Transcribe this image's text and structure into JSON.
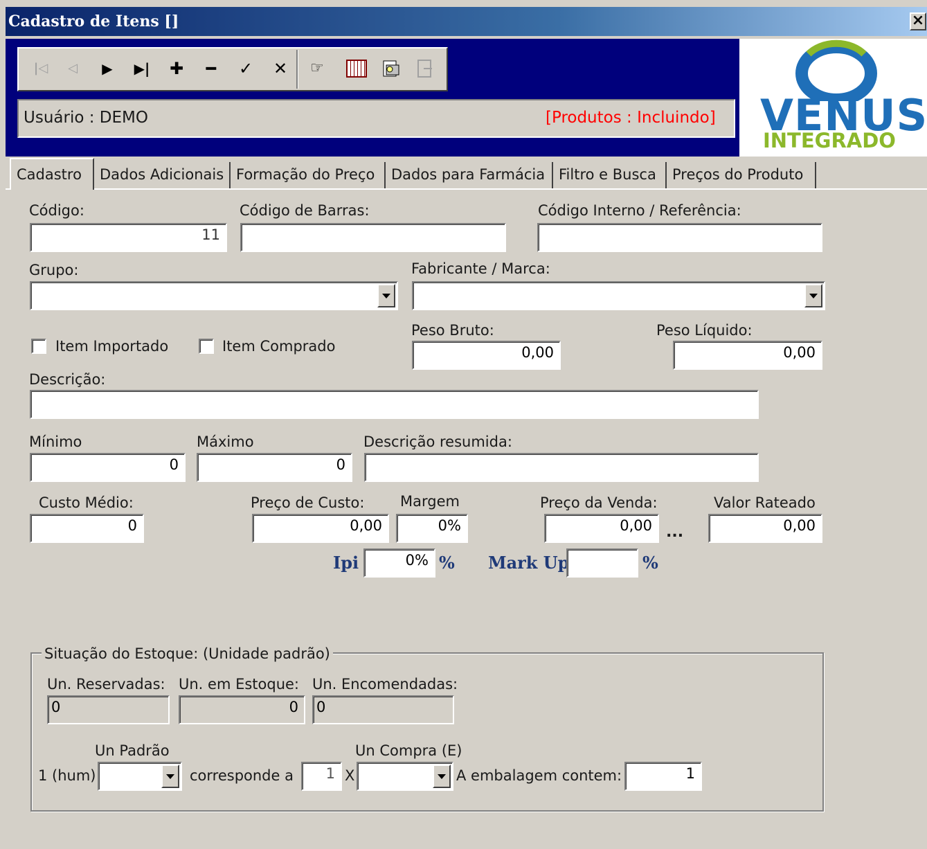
{
  "window": {
    "title": "Cadastro de Itens []",
    "close_label": "×"
  },
  "toolbar": {
    "icons": [
      "first-record-icon",
      "prev-record-icon",
      "next-record-icon",
      "last-record-icon",
      "add-icon",
      "remove-icon",
      "confirm-icon",
      "cancel-icon",
      "pointer-hand-icon",
      "calendar-grid-icon",
      "print-preview-icon",
      "exit-icon"
    ]
  },
  "status": {
    "user": "Usuário : DEMO",
    "mode": "[Produtos : Incluindo]",
    "mode_color": "#ff0000"
  },
  "logo": {
    "top": "VENUS",
    "bottom": "INTEGRADO",
    "brand_color": "#1f6fb8",
    "accent_color": "#8cb82b"
  },
  "tabs": [
    {
      "label": "Cadastro"
    },
    {
      "label": "Dados Adicionais"
    },
    {
      "label": "Formação do Preço"
    },
    {
      "label": "Dados para Farmácia"
    },
    {
      "label": "Filtro e Busca"
    },
    {
      "label": "Preços do Produto"
    }
  ],
  "form": {
    "codigo": {
      "label": "Código:",
      "value": "11"
    },
    "codigo_barras": {
      "label": "Código de Barras:",
      "value": ""
    },
    "codigo_interno": {
      "label": "Código Interno / Referência:",
      "value": ""
    },
    "grupo": {
      "label": "Grupo:",
      "value": ""
    },
    "fabricante": {
      "label": "Fabricante / Marca:",
      "value": ""
    },
    "item_importado": {
      "label": "Item Importado"
    },
    "item_comprado": {
      "label": "Item Comprado"
    },
    "peso_bruto": {
      "label": "Peso Bruto:",
      "value": "0,00"
    },
    "peso_liquido": {
      "label": "Peso Líquido:",
      "value": "0,00"
    },
    "descricao": {
      "label": "Descrição:",
      "value": ""
    },
    "minimo": {
      "label": "Mínimo",
      "value": "0"
    },
    "maximo": {
      "label": "Máximo",
      "value": "0"
    },
    "descricao_resumida": {
      "label": "Descrição resumida:",
      "value": ""
    },
    "custo_medio": {
      "label": "Custo Médio:",
      "value": "0"
    },
    "preco_custo": {
      "label": "Preço de Custo:",
      "value": "0,00"
    },
    "margem": {
      "label": "Margem",
      "value": "0%"
    },
    "preco_venda": {
      "label": "Preço da Venda:",
      "value": "0,00"
    },
    "ellipsis": "...",
    "valor_rateado": {
      "label": "Valor Rateado",
      "value": "0,00"
    },
    "ipi": {
      "label": "Ipi",
      "value": "0%",
      "suffix": "%"
    },
    "markup": {
      "label": "Mark Up",
      "value": "",
      "suffix": "%"
    }
  },
  "estoque": {
    "legend": "Situação do Estoque:  (Unidade padrão)",
    "reservadas": {
      "label": "Un. Reservadas:",
      "value": "0"
    },
    "em_estoque": {
      "label": "Un. em Estoque:",
      "value": "0"
    },
    "encomendadas": {
      "label": "Un. Encomendadas:",
      "value": "0"
    },
    "un_padrao_label": "Un Padrão",
    "un_compra_label": "Un Compra (E)",
    "hum_label": "1 (hum)",
    "corresponde_label": "corresponde a",
    "corresponde_value": "1",
    "x_label": "X",
    "embalagem_label": "A embalagem contem:",
    "embalagem_value": "1"
  }
}
